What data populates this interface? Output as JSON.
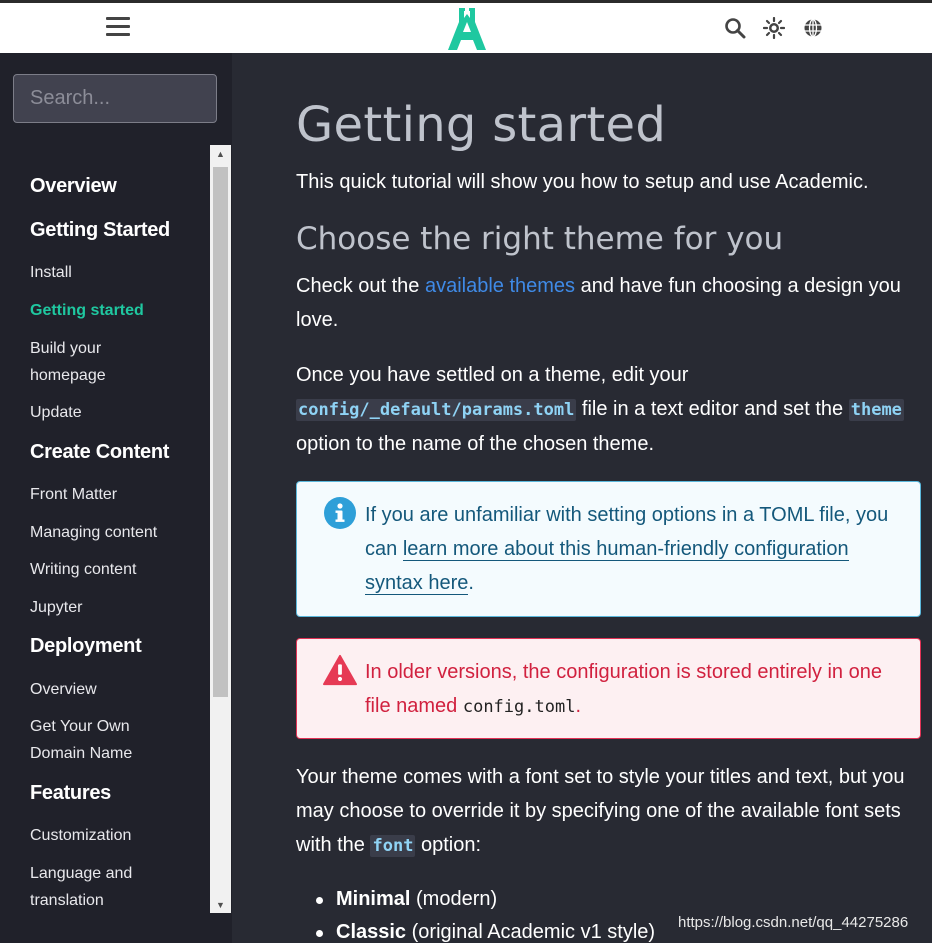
{
  "search": {
    "placeholder": "Search..."
  },
  "sidebar": {
    "items": [
      {
        "type": "section",
        "label": "Overview"
      },
      {
        "type": "section",
        "label": "Getting Started"
      },
      {
        "type": "link",
        "label": "Install"
      },
      {
        "type": "link",
        "label": "Getting started",
        "active": true
      },
      {
        "type": "link",
        "label": "Build your\nhomepage"
      },
      {
        "type": "link",
        "label": "Update"
      },
      {
        "type": "section",
        "label": "Create Content"
      },
      {
        "type": "link",
        "label": "Front Matter"
      },
      {
        "type": "link",
        "label": "Managing content"
      },
      {
        "type": "link",
        "label": "Writing content"
      },
      {
        "type": "link",
        "label": "Jupyter"
      },
      {
        "type": "section",
        "label": "Deployment"
      },
      {
        "type": "link",
        "label": "Overview"
      },
      {
        "type": "link",
        "label": "Get Your Own\nDomain Name"
      },
      {
        "type": "section",
        "label": "Features"
      },
      {
        "type": "link",
        "label": "Customization"
      },
      {
        "type": "link",
        "label": "Language and\ntranslation"
      }
    ]
  },
  "main": {
    "title": "Getting started",
    "intro": "This quick tutorial will show you how to setup and use Academic.",
    "h2": "Choose the right theme for you",
    "p1": {
      "before": "Check out the ",
      "link": "available themes",
      "after": " and have fun choosing a design you love."
    },
    "p2": {
      "t1": "Once you have settled on a theme, edit your ",
      "code1": "config/_default/params.toml",
      "t2": " file in a text editor and set the ",
      "code2": "theme",
      "t3": " option to the name of the chosen theme."
    },
    "info_alert": {
      "before": "If you are unfamiliar with setting options in a TOML file, you can ",
      "link": "learn more about this human-friendly configuration syntax here",
      "after": "."
    },
    "warn_alert": {
      "before": "In older versions, the configuration is stored entirely in one file named ",
      "code": "config.toml",
      "after": "."
    },
    "p3": {
      "before": "Your theme comes with a font set to style your titles and text, but you may choose to override it by specifying one of the available font sets with the ",
      "code": "font",
      "after": " option:"
    },
    "bullets": [
      {
        "bold": "Minimal",
        "rest": " (modern)"
      },
      {
        "bold": "Classic",
        "rest": " (original Academic v1 style)"
      }
    ]
  },
  "watermark": "https://blog.csdn.net/qq_44275286",
  "colors": {
    "accent": "#1fc8a0",
    "link": "#3f8ae6",
    "info": "#14587b",
    "danger": "#d1213f"
  }
}
